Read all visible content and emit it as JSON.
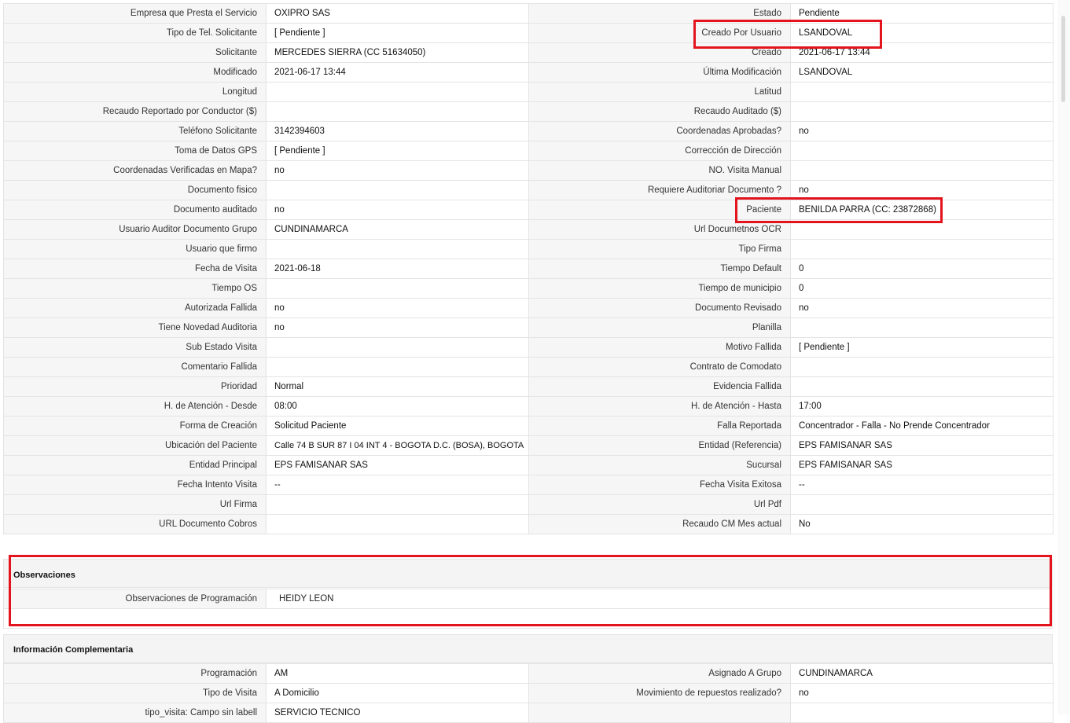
{
  "detail_rows": [
    {
      "l1": "Empresa que Presta el Servicio",
      "v1": "OXIPRO SAS",
      "l2": "Estado",
      "v2": "Pendiente"
    },
    {
      "l1": "Tipo de Tel. Solicitante",
      "v1": "[ Pendiente ]",
      "l2": "Creado Por Usuario",
      "v2": "LSANDOVAL"
    },
    {
      "l1": "Solicitante",
      "v1": "MERCEDES SIERRA (CC 51634050)",
      "l2": "Creado",
      "v2": "2021-06-17 13:44"
    },
    {
      "l1": "Modificado",
      "v1": "2021-06-17 13:44",
      "l2": "Última Modificación",
      "v2": "LSANDOVAL"
    },
    {
      "l1": "Longitud",
      "v1": "",
      "l2": "Latitud",
      "v2": ""
    },
    {
      "l1": "Recaudo Reportado por Conductor ($)",
      "v1": "",
      "l2": "Recaudo Auditado ($)",
      "v2": ""
    },
    {
      "l1": "Teléfono Solicitante",
      "v1": "3142394603",
      "l2": "Coordenadas Aprobadas?",
      "v2": "no"
    },
    {
      "l1": "Toma de Datos GPS",
      "v1": "[ Pendiente ]",
      "l2": "Corrección de Dirección",
      "v2": ""
    },
    {
      "l1": "Coordenadas Verificadas en Mapa?",
      "v1": "no",
      "l2": "NO. Visita Manual",
      "v2": ""
    },
    {
      "l1": "Documento fisico",
      "v1": "",
      "l2": "Requiere Auditoriar Documento ?",
      "v2": "no"
    },
    {
      "l1": "Documento auditado",
      "v1": "no",
      "l2": "Paciente",
      "v2": "BENILDA PARRA (CC: 23872868)"
    },
    {
      "l1": "Usuario Auditor Documento Grupo",
      "v1": "CUNDINAMARCA",
      "l2": "Url Documetnos OCR",
      "v2": ""
    },
    {
      "l1": "Usuario que firmo",
      "v1": "",
      "l2": "Tipo Firma",
      "v2": ""
    },
    {
      "l1": "Fecha de Visita",
      "v1": "2021-06-18",
      "l2": "Tiempo Default",
      "v2": "0"
    },
    {
      "l1": "Tiempo OS",
      "v1": "",
      "l2": "Tiempo de municipio",
      "v2": "0"
    },
    {
      "l1": "Autorizada Fallida",
      "v1": "no",
      "l2": "Documento Revisado",
      "v2": "no"
    },
    {
      "l1": "Tiene Novedad Auditoria",
      "v1": "no",
      "l2": "Planilla",
      "v2": ""
    },
    {
      "l1": "Sub Estado Visita",
      "v1": "",
      "l2": "Motivo Fallida",
      "v2": "[ Pendiente ]"
    },
    {
      "l1": "Comentario Fallida",
      "v1": "",
      "l2": "Contrato de Comodato",
      "v2": ""
    },
    {
      "l1": "Prioridad",
      "v1": "Normal",
      "l2": "Evidencia Fallida",
      "v2": ""
    },
    {
      "l1": "H. de Atención - Desde",
      "v1": "08:00",
      "l2": "H. de Atención - Hasta",
      "v2": "17:00"
    },
    {
      "l1": "Forma de Creación",
      "v1": "Solicitud Paciente",
      "l2": "Falla Reportada",
      "v2": "Concentrador - Falla - No Prende Concentrador"
    },
    {
      "l1": "Ubicación del Paciente",
      "v1": "Calle 74 B SUR 87 I 04 INT 4 - BOGOTA D.C. (BOSA), BOGOTA",
      "l2": "Entidad (Referencia)",
      "v2": "EPS FAMISANAR SAS"
    },
    {
      "l1": "Entidad Principal",
      "v1": "EPS FAMISANAR SAS",
      "l2": "Sucursal",
      "v2": "EPS FAMISANAR SAS"
    },
    {
      "l1": "Fecha Intento Visita",
      "v1": "--",
      "l2": "Fecha Visita Exitosa",
      "v2": "--"
    },
    {
      "l1": "Url Firma",
      "v1": "",
      "l2": "Url Pdf",
      "v2": ""
    },
    {
      "l1": "URL Documento Cobros",
      "v1": "",
      "l2": "Recaudo CM Mes actual",
      "v2": "No"
    }
  ],
  "observaciones": {
    "title": "Observaciones",
    "label": "Observaciones de Programación",
    "value": "HEIDY LEON"
  },
  "info_complementaria": {
    "title": "Información Complementaria",
    "rows": [
      {
        "l1": "Programación",
        "v1": "AM",
        "l2": "Asignado A Grupo",
        "v2": "CUNDINAMARCA"
      },
      {
        "l1": "Tipo de Visita",
        "v1": "A Domicilio",
        "l2": "Movimiento de repuestos realizado?",
        "v2": "no"
      },
      {
        "l1": "tipo_visita: Campo sin labell",
        "v1": "SERVICIO TECNICO",
        "l2": "",
        "v2": ""
      }
    ]
  },
  "colors": {
    "highlight": "#e3141e",
    "label_bg": "#f6f6f6",
    "border": "#e4e4e4"
  }
}
